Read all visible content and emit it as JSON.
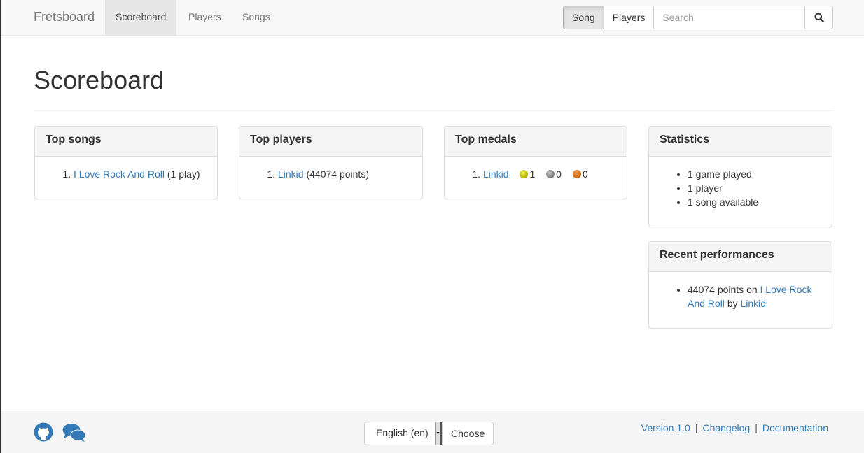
{
  "navbar": {
    "brand": "Fretsboard",
    "items": [
      {
        "label": "Scoreboard",
        "active": true
      },
      {
        "label": "Players",
        "active": false
      },
      {
        "label": "Songs",
        "active": false
      }
    ],
    "search": {
      "mode_buttons": [
        {
          "label": "Song",
          "active": true
        },
        {
          "label": "Players",
          "active": false
        }
      ],
      "placeholder": "Search",
      "value": "",
      "submit_icon": "search-icon"
    }
  },
  "page": {
    "title": "Scoreboard"
  },
  "panels": {
    "top_songs": {
      "title": "Top songs",
      "items": [
        {
          "rank": "1.",
          "link": "I Love Rock And Roll",
          "suffix": "(1 play)"
        }
      ]
    },
    "top_players": {
      "title": "Top players",
      "items": [
        {
          "rank": "1.",
          "link": "Linkid",
          "suffix": "(44074 points)"
        }
      ]
    },
    "top_medals": {
      "title": "Top medals",
      "items": [
        {
          "rank": "1.",
          "link": "Linkid",
          "gold": "1",
          "silver": "0",
          "bronze": "0"
        }
      ],
      "medal_colors": {
        "gold": "#c8c800",
        "silver": "#888888",
        "bronze": "#d07020"
      }
    },
    "statistics": {
      "title": "Statistics",
      "items": [
        "1 game played",
        "1 player",
        "1 song available"
      ]
    },
    "recent_performances": {
      "title": "Recent performances",
      "items": [
        {
          "points_text": "44074 points on",
          "song": "I Love Rock And Roll",
          "by": "by",
          "player": "Linkid"
        }
      ]
    }
  },
  "footer": {
    "icons": [
      "github-icon",
      "chat-icon"
    ],
    "language": {
      "selected": "English (en)",
      "button": "Choose"
    },
    "links": [
      "Version 1.0",
      "Changelog",
      "Documentation"
    ],
    "separator": "|"
  },
  "colors": {
    "link": "#337ab7",
    "navbar_bg": "#f8f8f8",
    "panel_heading_bg": "#f5f5f5"
  }
}
